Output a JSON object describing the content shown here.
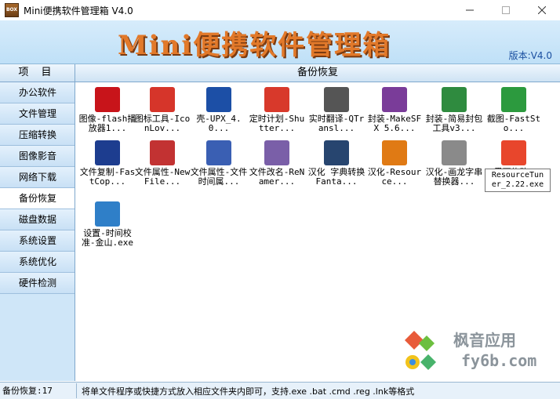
{
  "window": {
    "title": "Mini便携软件管理箱 V4.0",
    "icon_text": "BOX"
  },
  "banner": {
    "title": "Mini便携软件管理箱",
    "version": "版本:V4.0"
  },
  "sidebar": {
    "header": "项 目",
    "items": [
      {
        "label": "办公软件"
      },
      {
        "label": "文件管理"
      },
      {
        "label": "压缩转换"
      },
      {
        "label": "图像影音"
      },
      {
        "label": "网络下载"
      },
      {
        "label": "备份恢复"
      },
      {
        "label": "磁盘数据"
      },
      {
        "label": "系统设置"
      },
      {
        "label": "系统优化"
      },
      {
        "label": "硬件检测"
      }
    ],
    "active_index": 5
  },
  "main": {
    "header": "备份恢复",
    "items": [
      {
        "label": "图像-flash播放器1...",
        "icon": "flash-icon",
        "color": "#c8141a"
      },
      {
        "label": "图标工具-IconLov...",
        "icon": "heart-icon",
        "color": "#d6352a"
      },
      {
        "label": "壳-UPX_4.0...",
        "icon": "upx-icon",
        "color": "#1c4fa6"
      },
      {
        "label": "定时计划-Shutter...",
        "icon": "power-icon",
        "color": "#d8392b"
      },
      {
        "label": "实时翻译-QTransl...",
        "icon": "bubble-icon",
        "color": "#555555"
      },
      {
        "label": "封装-MakeSFX 5.6...",
        "icon": "archive-icon",
        "color": "#7a3c99"
      },
      {
        "label": "封装-简易封包工具v3...",
        "icon": "shield-icon",
        "color": "#2f8b3f"
      },
      {
        "label": "截图-FastSto...",
        "icon": "screenshot-icon",
        "color": "#2c9a3e"
      },
      {
        "label": "文件复制-FastCop...",
        "icon": "fc-icon",
        "color": "#1d3d8f"
      },
      {
        "label": "文件属性-NewFile...",
        "icon": "file-grid-icon",
        "color": "#c23232"
      },
      {
        "label": "文件属性-文件时间属...",
        "icon": "wizard-icon",
        "color": "#3a5fb3"
      },
      {
        "label": "文件改名-ReNamer...",
        "icon": "folder-icon",
        "color": "#7a5fa8"
      },
      {
        "label": "汉化 字典转换 Fanta...",
        "icon": "globe-icon",
        "color": "#27456f"
      },
      {
        "label": "汉化-Resource...",
        "icon": "rh-icon",
        "color": "#e07a14"
      },
      {
        "label": "汉化-画龙字串替换器...",
        "icon": "edit-icon",
        "color": "#8a8a8a"
      },
      {
        "label": "界面修改-",
        "icon": "diamond-icon",
        "color": "#e8462c"
      },
      {
        "label": "设置-时间校准-金山.exe",
        "icon": "clock-sync-icon",
        "color": "#2f7fc8"
      }
    ]
  },
  "tooltip": {
    "lines": [
      "ResourceTun",
      "er_2.22.exe"
    ]
  },
  "watermark": {
    "line1": "枫音应用",
    "line2": "fy6b.com"
  },
  "status": {
    "left": "备份恢复:17",
    "right": "将单文件程序或快捷方式放入相应文件夹内即可，支持.exe .bat .cmd .reg .lnk等格式"
  }
}
